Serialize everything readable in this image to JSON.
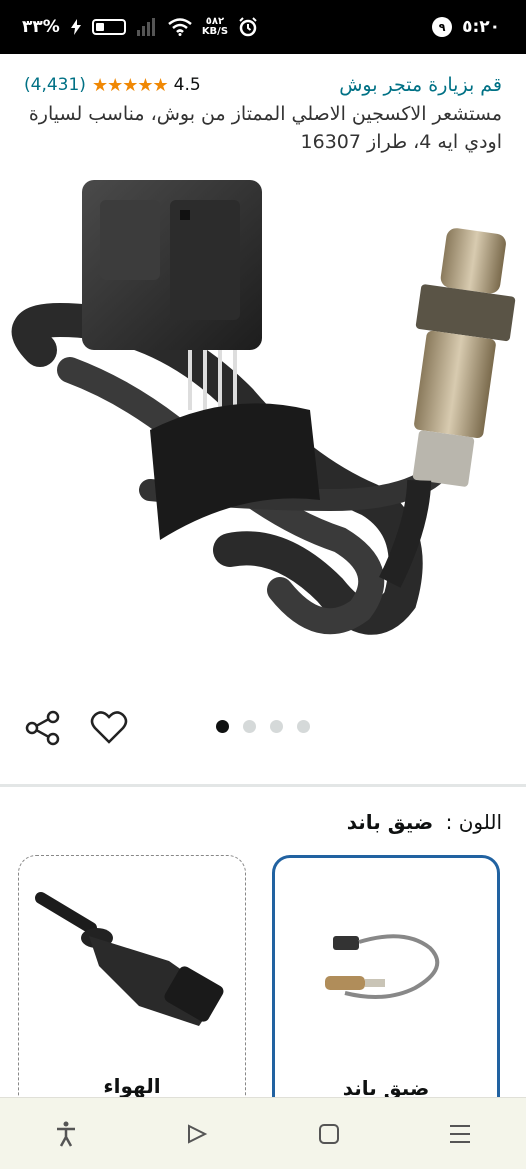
{
  "status_bar": {
    "time": "٥:٢٠",
    "notification_count": "٩",
    "speed_value": "٥٨٢",
    "speed_unit": "KB/S",
    "battery": "٣٣%"
  },
  "header": {
    "store_link": "قم بزيارة متجر بوش",
    "rating_value": "4.5",
    "stars": "★★★★★",
    "rating_count": "(4,431)",
    "product_title": "مستشعر الاكسجين الاصلي الممتاز من بوش، مناسب لسيارة اودي ايه 4، طراز 16307"
  },
  "gallery": {
    "image_count": 4,
    "active_index": 0
  },
  "variant": {
    "label": "اللون :",
    "selected": "ضيق باند",
    "options": [
      {
        "label": "ضيق باند",
        "selected": true
      },
      {
        "label": "الهواء",
        "selected": false
      }
    ]
  },
  "colors": {
    "link": "#007185",
    "star": "#f08804",
    "selected_border": "#2162a1"
  }
}
